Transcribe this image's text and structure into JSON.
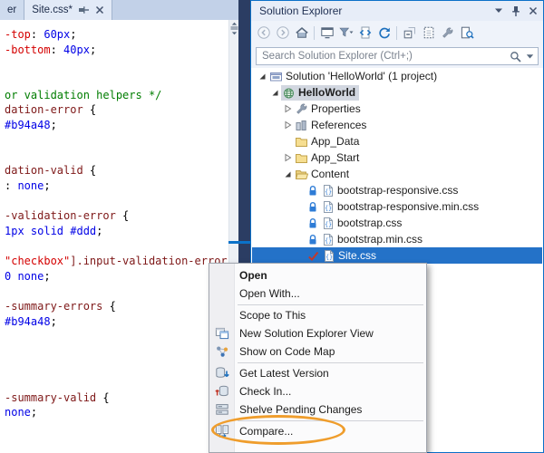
{
  "editor": {
    "partial_tab_label": "er",
    "active_tab_label": "Site.css*",
    "code_lines": [
      [
        [
          "prop",
          "-top"
        ],
        [
          "pun",
          ": "
        ],
        [
          "val",
          "60px"
        ],
        [
          "pun",
          ";"
        ]
      ],
      [
        [
          "prop",
          "-bottom"
        ],
        [
          "pun",
          ": "
        ],
        [
          "val",
          "40px"
        ],
        [
          "pun",
          ";"
        ]
      ],
      [],
      [],
      [
        [
          "com",
          "or validation helpers */"
        ]
      ],
      [
        [
          "sel",
          "dation-error "
        ],
        [
          "pun",
          "{"
        ]
      ],
      [
        [
          "val",
          "#b94a48"
        ],
        [
          "pun",
          ";"
        ]
      ],
      [],
      [],
      [
        [
          "sel",
          "dation-valid "
        ],
        [
          "pun",
          "{"
        ]
      ],
      [
        [
          "pun",
          ": "
        ],
        [
          "val",
          "none"
        ],
        [
          "pun",
          ";"
        ]
      ],
      [],
      [
        [
          "sel",
          "-validation-error "
        ],
        [
          "pun",
          "{"
        ]
      ],
      [
        [
          "val",
          "1px solid #ddd"
        ],
        [
          "pun",
          ";"
        ]
      ],
      [],
      [
        [
          "str",
          "\"checkbox\""
        ],
        [
          "sel",
          "].input-validation-error"
        ]
      ],
      [
        [
          "val",
          "0 none"
        ],
        [
          "pun",
          ";"
        ]
      ],
      [],
      [
        [
          "sel",
          "-summary-errors "
        ],
        [
          "pun",
          "{"
        ]
      ],
      [
        [
          "val",
          "#b94a48"
        ],
        [
          "pun",
          ";"
        ]
      ],
      [],
      [],
      [],
      [],
      [
        [
          "sel",
          "-summary-valid "
        ],
        [
          "pun",
          "{"
        ]
      ],
      [
        [
          "val",
          "none"
        ],
        [
          "pun",
          ";"
        ]
      ]
    ]
  },
  "solution_explorer": {
    "title": "Solution Explorer",
    "search_placeholder": "Search Solution Explorer (Ctrl+;)",
    "toolbar_icons": [
      "back",
      "forward",
      "home",
      "switch-views",
      "pending-filter",
      "sync-active-document",
      "refresh",
      "collapse-all",
      "show-all-files",
      "properties",
      "preview-selected"
    ],
    "title_buttons": [
      "window-position",
      "pin",
      "close"
    ],
    "tree": [
      {
        "indent": 0,
        "arrow": "expanded",
        "icon": "solution",
        "label": "Solution 'HelloWorld' (1 project)"
      },
      {
        "indent": 1,
        "arrow": "expanded",
        "icon": "project",
        "label": "HelloWorld",
        "bold": true,
        "inactive_selected": true
      },
      {
        "indent": 2,
        "arrow": "collapsed",
        "icon": "properties",
        "label": "Properties"
      },
      {
        "indent": 2,
        "arrow": "collapsed",
        "icon": "references",
        "label": "References"
      },
      {
        "indent": 2,
        "arrow": "none",
        "icon": "folder",
        "label": "App_Data"
      },
      {
        "indent": 2,
        "arrow": "collapsed",
        "icon": "folder",
        "label": "App_Start"
      },
      {
        "indent": 2,
        "arrow": "expanded",
        "icon": "folder-open",
        "label": "Content"
      },
      {
        "indent": 3,
        "arrow": "none",
        "status": "lock",
        "icon": "css-file",
        "label": "bootstrap-responsive.css"
      },
      {
        "indent": 3,
        "arrow": "none",
        "status": "lock",
        "icon": "css-file",
        "label": "bootstrap-responsive.min.css"
      },
      {
        "indent": 3,
        "arrow": "none",
        "status": "lock",
        "icon": "css-file",
        "label": "bootstrap.css"
      },
      {
        "indent": 3,
        "arrow": "none",
        "status": "lock",
        "icon": "css-file",
        "label": "bootstrap.min.css"
      },
      {
        "indent": 3,
        "arrow": "none",
        "status": "checkmark",
        "icon": "css-file",
        "label": "Site.css",
        "selected": true
      }
    ]
  },
  "context_menu": {
    "items": [
      {
        "type": "item",
        "label": "Open",
        "bold": true
      },
      {
        "type": "item",
        "label": "Open With..."
      },
      {
        "type": "separator"
      },
      {
        "type": "item",
        "label": "Scope to This"
      },
      {
        "type": "item",
        "label": "New Solution Explorer View",
        "icon": "new-solution-explorer-view"
      },
      {
        "type": "item",
        "label": "Show on Code Map",
        "icon": "code-map"
      },
      {
        "type": "separator"
      },
      {
        "type": "item",
        "label": "Get Latest Version",
        "icon": "get-latest"
      },
      {
        "type": "item",
        "label": "Check In...",
        "icon": "check-in"
      },
      {
        "type": "item",
        "label": "Shelve Pending Changes",
        "icon": "shelve"
      },
      {
        "type": "separator"
      },
      {
        "type": "item",
        "label": "Compare...",
        "icon": "compare",
        "annotated": true
      }
    ]
  },
  "annotation": {
    "color": "#EF9D2C"
  },
  "colors": {
    "accent": "#0C70C8",
    "selection": "#2472C8",
    "ide_background": "#2B3D63"
  }
}
